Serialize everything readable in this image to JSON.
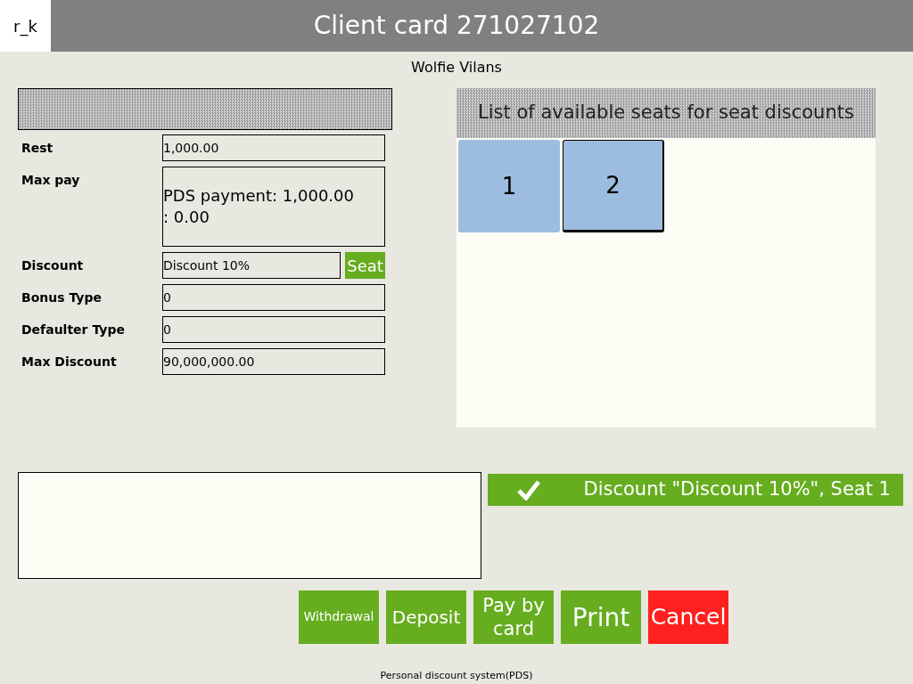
{
  "header": {
    "logo": "r_k",
    "title": "Client card 271027102"
  },
  "client_name": "Wolfie Vilans",
  "fields": [
    {
      "label": "Rest",
      "value": "1,000.00",
      "kind": "text"
    },
    {
      "label": "Max pay",
      "value": "PDS payment: 1,000.00\n: 0.00",
      "kind": "multiline"
    },
    {
      "label": "Discount",
      "value": "Discount 10%",
      "kind": "with_button",
      "button": "Seat"
    },
    {
      "label": "Bonus Type",
      "value": "0",
      "kind": "text"
    },
    {
      "label": "Defaulter Type",
      "value": "0",
      "kind": "text"
    },
    {
      "label": "Max Discount",
      "value": "90,000,000.00",
      "kind": "text"
    }
  ],
  "seats_panel": {
    "title": "List of available seats for seat discounts",
    "seats": [
      {
        "label": "1",
        "selected": false
      },
      {
        "label": "2",
        "selected": true
      }
    ]
  },
  "status": {
    "text": "Discount \"Discount 10%\", Seat 1"
  },
  "buttons": [
    {
      "label": "Withdrawal",
      "kind": "action"
    },
    {
      "label": "Deposit",
      "kind": "action"
    },
    {
      "label": "Pay by card",
      "kind": "action"
    },
    {
      "label": "Print",
      "kind": "action"
    },
    {
      "label": "Cancel",
      "kind": "cancel"
    }
  ],
  "footer": "Personal discount system(PDS)"
}
